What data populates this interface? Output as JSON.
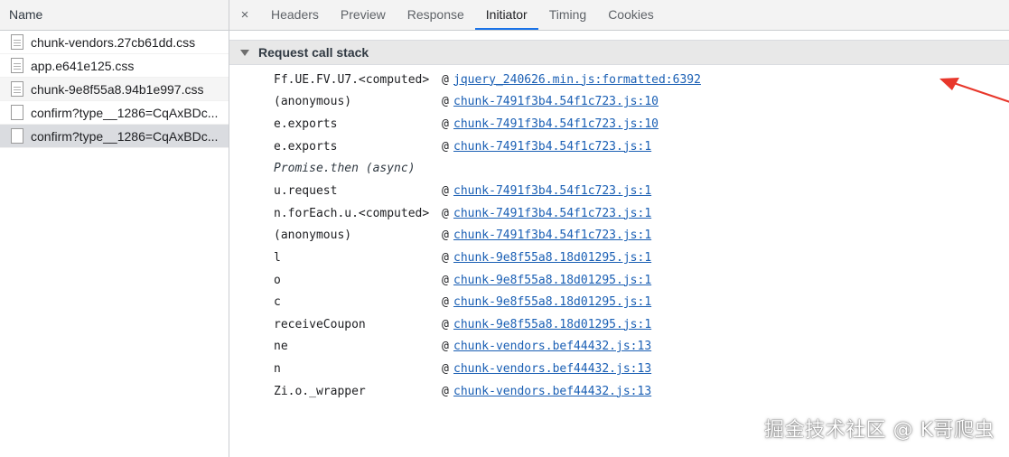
{
  "left_panel": {
    "header": "Name",
    "files": [
      {
        "name": "chunk-vendors.27cb61dd.css",
        "icon": "file-icon"
      },
      {
        "name": "app.e641e125.css",
        "icon": "file-icon"
      },
      {
        "name": "chunk-9e8f55a8.94b1e997.css",
        "icon": "file-icon"
      },
      {
        "name": "confirm?type__1286=CqAxBDc...",
        "icon": "blank-file-icon"
      },
      {
        "name": "confirm?type__1286=CqAxBDc...",
        "icon": "blank-file-icon"
      }
    ]
  },
  "tabs": {
    "close": "×",
    "items": [
      "Headers",
      "Preview",
      "Response",
      "Initiator",
      "Timing",
      "Cookies"
    ],
    "active": "Initiator"
  },
  "section": {
    "title": "Request call stack"
  },
  "call_stack": {
    "rows": [
      {
        "fn": "Ff.UE.FV.U7.<computed>",
        "at": "@",
        "loc": "jquery_240626.min.js:formatted:6392"
      },
      {
        "fn": "(anonymous)",
        "at": "@",
        "loc": "chunk-7491f3b4.54f1c723.js:10"
      },
      {
        "fn": "e.exports",
        "at": "@",
        "loc": "chunk-7491f3b4.54f1c723.js:10"
      },
      {
        "fn": "e.exports",
        "at": "@",
        "loc": "chunk-7491f3b4.54f1c723.js:1"
      }
    ],
    "async_label": "Promise.then (async)",
    "rows_after": [
      {
        "fn": "u.request",
        "at": "@",
        "loc": "chunk-7491f3b4.54f1c723.js:1"
      },
      {
        "fn": "n.forEach.u.<computed>",
        "at": "@",
        "loc": "chunk-7491f3b4.54f1c723.js:1"
      },
      {
        "fn": "(anonymous)",
        "at": "@",
        "loc": "chunk-7491f3b4.54f1c723.js:1"
      },
      {
        "fn": "l",
        "at": "@",
        "loc": "chunk-9e8f55a8.18d01295.js:1"
      },
      {
        "fn": "o",
        "at": "@",
        "loc": "chunk-9e8f55a8.18d01295.js:1"
      },
      {
        "fn": "c",
        "at": "@",
        "loc": "chunk-9e8f55a8.18d01295.js:1"
      },
      {
        "fn": "receiveCoupon",
        "at": "@",
        "loc": "chunk-9e8f55a8.18d01295.js:1"
      },
      {
        "fn": "ne",
        "at": "@",
        "loc": "chunk-vendors.bef44432.js:13"
      },
      {
        "fn": "n",
        "at": "@",
        "loc": "chunk-vendors.bef44432.js:13"
      },
      {
        "fn": "Zi.o._wrapper",
        "at": "@",
        "loc": "chunk-vendors.bef44432.js:13"
      }
    ]
  },
  "annotation": {
    "arrow_color": "#e8372b"
  },
  "watermark": "掘金技术社区 @ K哥爬虫",
  "colors": {
    "link": "#1a5fb4",
    "tab_active_underline": "#1a73e8"
  }
}
